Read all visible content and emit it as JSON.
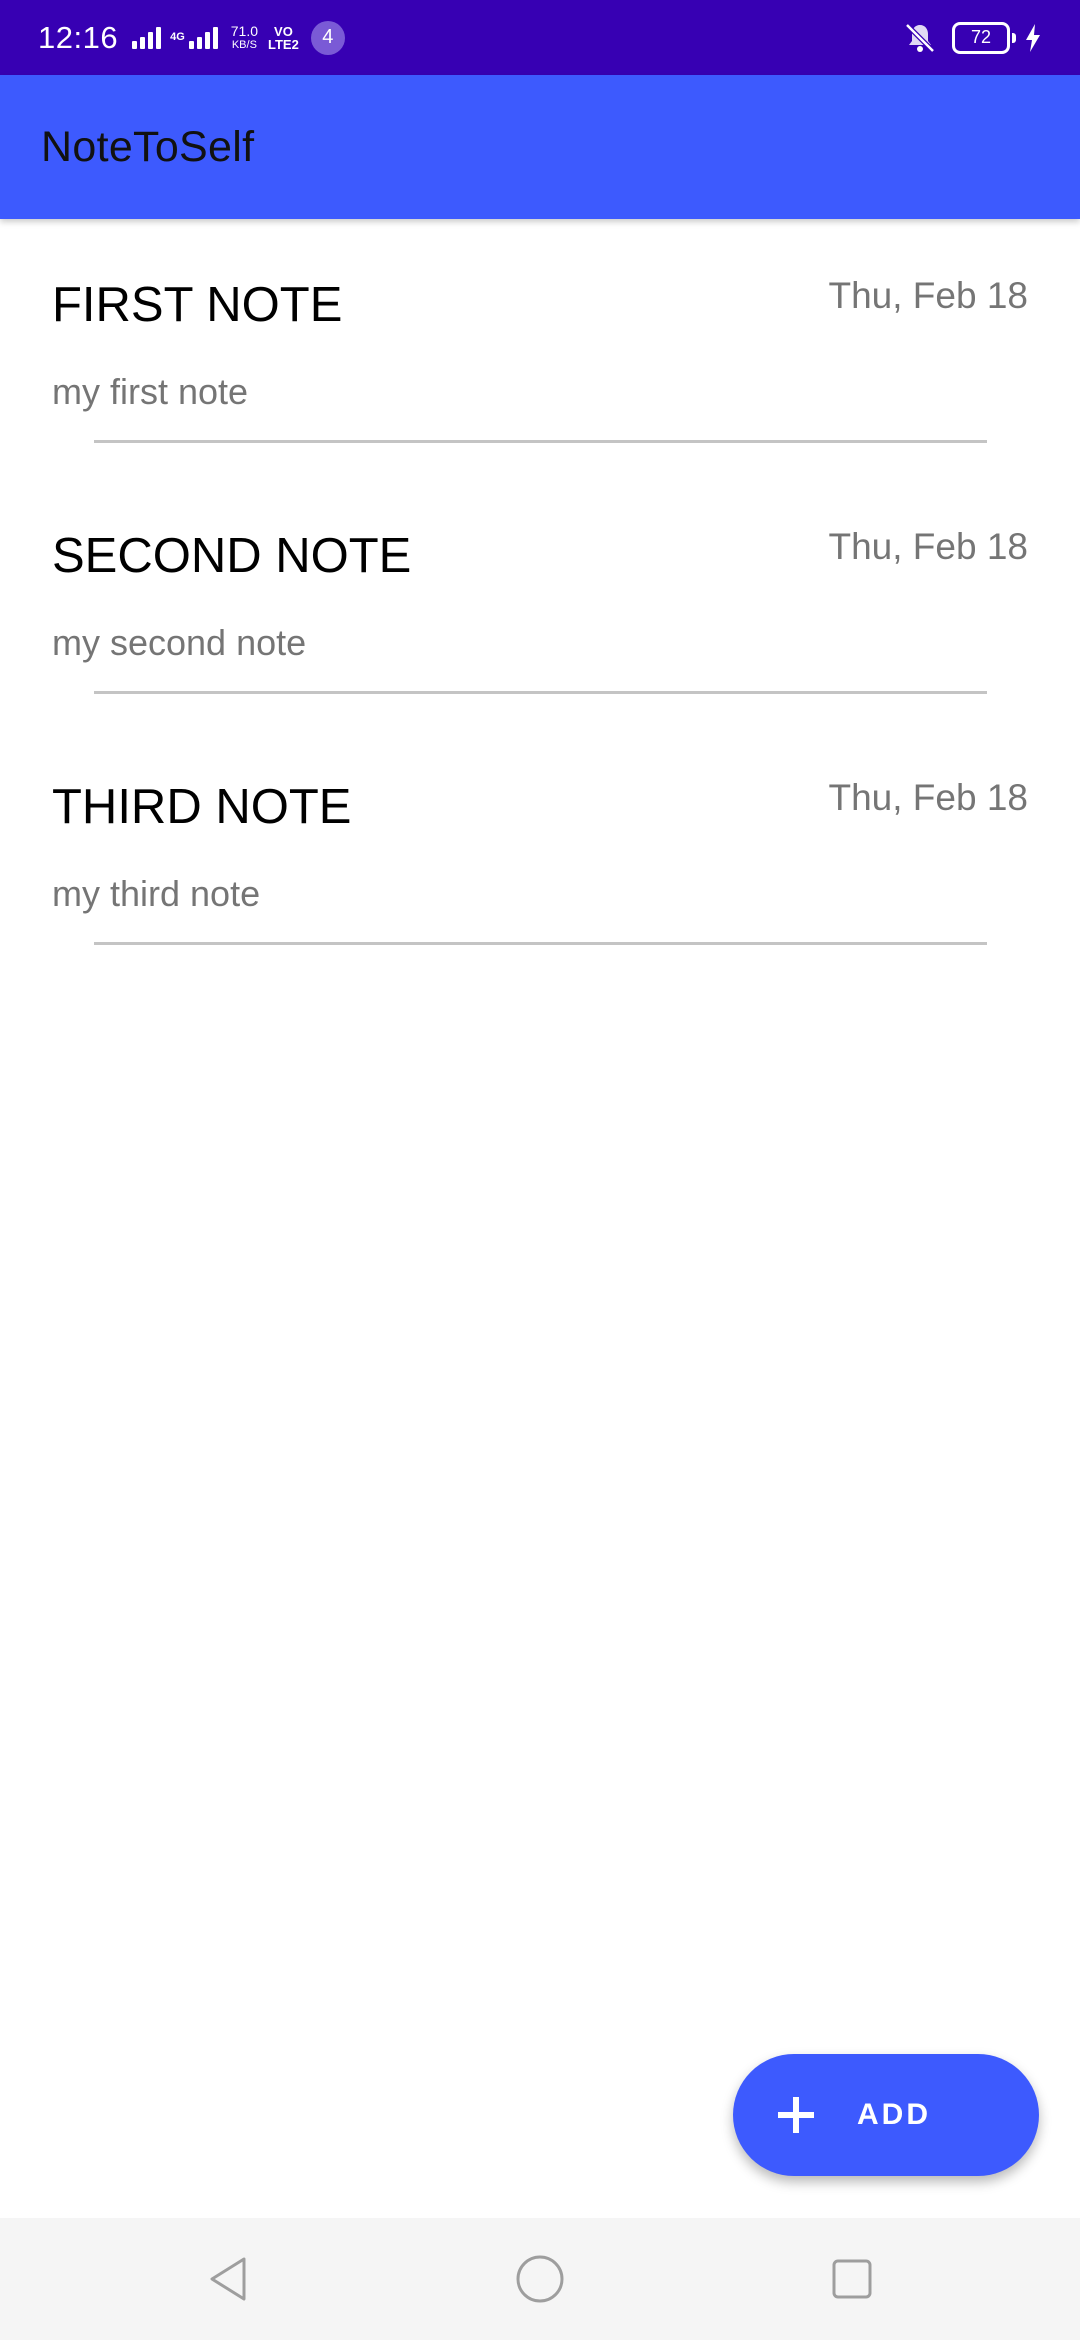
{
  "status_bar": {
    "time": "12:16",
    "network_type": "4G",
    "net_speed_value": "71.0",
    "net_speed_unit": "KB/S",
    "volte_top": "VO",
    "volte_bottom": "LTE2",
    "notification_count": "4",
    "battery_level": "72",
    "icons": [
      "signal-icon",
      "signal-icon",
      "mute-icon",
      "battery-icon",
      "charging-bolt-icon"
    ]
  },
  "app_bar": {
    "title": "NoteToSelf"
  },
  "notes": [
    {
      "title": "FIRST NOTE",
      "date": "Thu, Feb 18",
      "body": "my first note"
    },
    {
      "title": "SECOND NOTE",
      "date": "Thu, Feb 18",
      "body": "my second note"
    },
    {
      "title": "THIRD NOTE",
      "date": "Thu, Feb 18",
      "body": "my third note"
    }
  ],
  "fab": {
    "label": "ADD",
    "icon": "plus-icon"
  },
  "nav_bar": {
    "icons": [
      "back-icon",
      "home-icon",
      "recents-icon"
    ]
  },
  "colors": {
    "status_bar": "#3700b3",
    "app_bar": "#3d5afe",
    "fab": "#3d5afe",
    "secondary_text": "#757575"
  }
}
